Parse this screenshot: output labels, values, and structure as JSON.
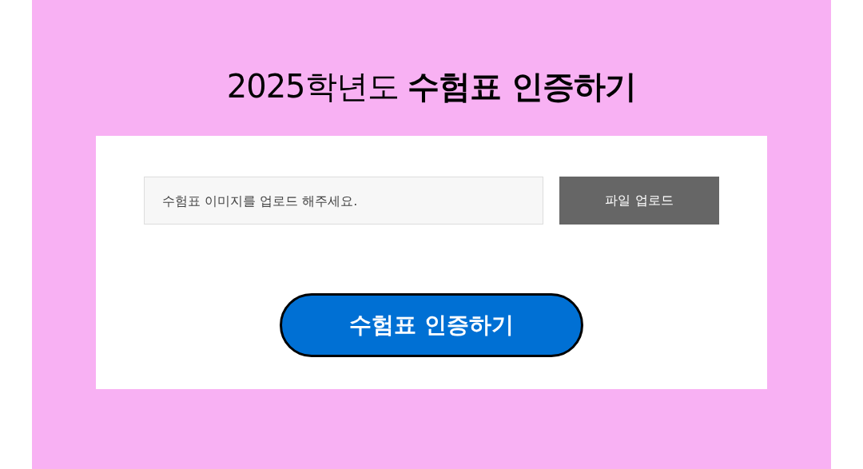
{
  "title": "2025학년도 **수험표 인증하기**",
  "upload": {
    "placeholder": "수험표 이미지를 업로드 해주세요.",
    "button": "파일 업로드"
  },
  "submit": {
    "label": "수험표 인증하기"
  }
}
